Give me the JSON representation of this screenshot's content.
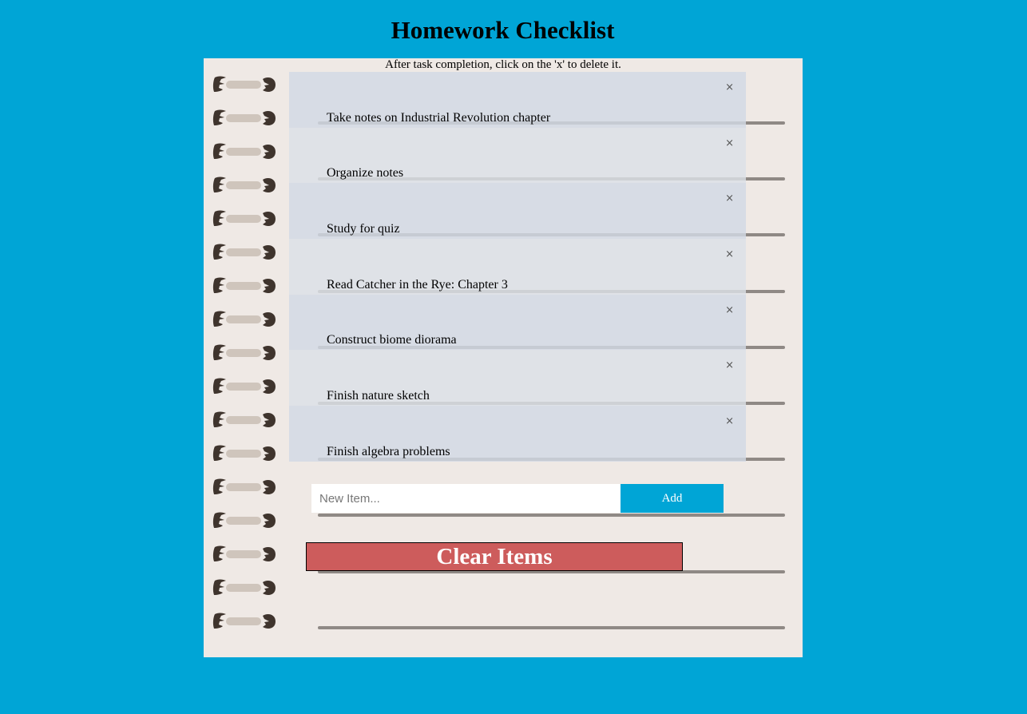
{
  "header": {
    "title": "Homework Checklist"
  },
  "notebook": {
    "instructions": "After task completion, click on the 'x' to delete it."
  },
  "tasks": [
    {
      "text": "Take notes on Industrial Revolution chapter",
      "delete_label": "×"
    },
    {
      "text": "Organize notes",
      "delete_label": "×"
    },
    {
      "text": "Study for quiz",
      "delete_label": "×"
    },
    {
      "text": "Read Catcher in the Rye: Chapter 3",
      "delete_label": "×"
    },
    {
      "text": "Construct biome diorama",
      "delete_label": "×"
    },
    {
      "text": "Finish nature sketch",
      "delete_label": "×"
    },
    {
      "text": "Finish algebra problems",
      "delete_label": "×"
    }
  ],
  "form": {
    "input_value": "",
    "input_placeholder": "New Item...",
    "add_label": "Add"
  },
  "clear": {
    "label": "Clear Items"
  },
  "colors": {
    "page_background": "#00a5d6",
    "notebook_paper": "#efe9e5",
    "clear_button": "#cd5c5c",
    "add_button": "#00a5d6"
  },
  "icons": {
    "spiral": "notebook-spiral-ring-icon",
    "delete": "close-x-icon"
  }
}
